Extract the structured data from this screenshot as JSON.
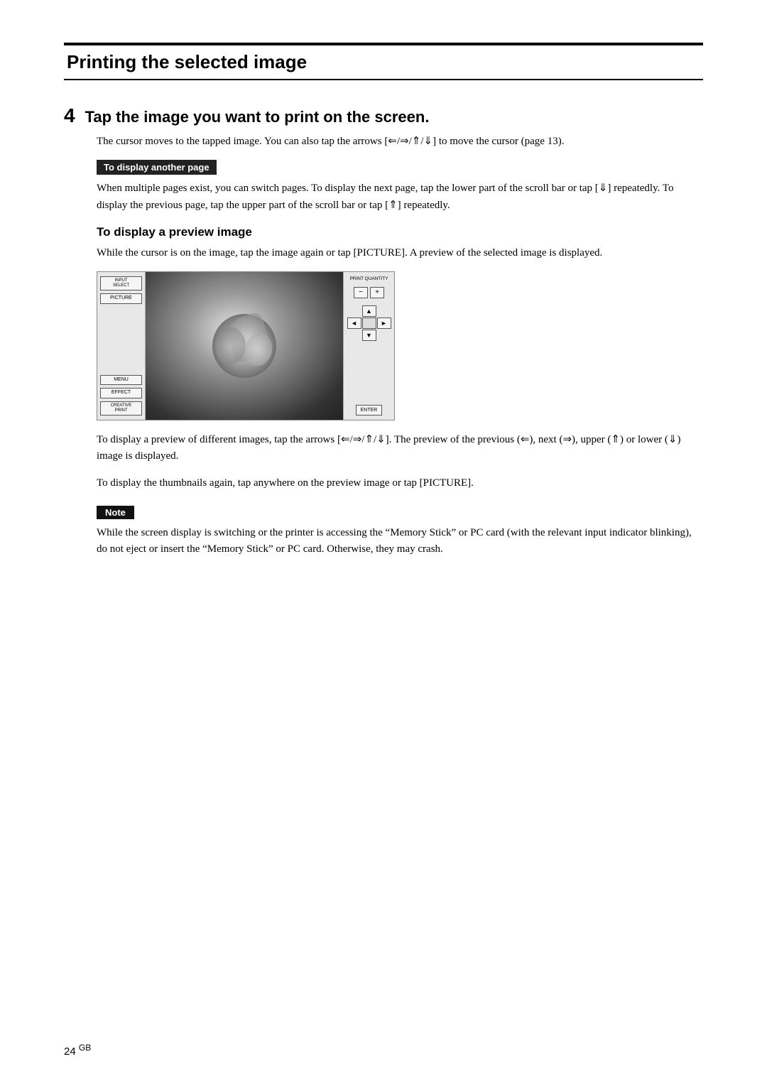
{
  "page": {
    "section_title": "Printing the selected image",
    "step_number": "4",
    "step_title": "Tap the image you want to print on the screen.",
    "step_desc": "The cursor moves to the tapped image.  You can also tap the arrows [⇐/⇒/⇑/⇓] to move the cursor (page 13).",
    "note_box_label": "To display another page",
    "note_box_text": "When multiple pages exist, you can switch pages. To display the next page, tap the lower part of the scroll bar or tap [⇓] repeatedly.  To display the previous page, tap the upper part of the scroll bar or tap [⇑] repeatedly.",
    "sub_heading": "To display a preview image",
    "sub_body_1": "While the cursor is on the image, tap the image again or tap [PICTURE]. A preview of the selected image is displayed.",
    "preview_desc_1": "To display a preview of different images, tap the arrows [⇐/⇒/⇑/⇓].  The preview of  the previous (⇐), next (⇒), upper (⇑) or lower (⇓) image is displayed.",
    "preview_desc_2": "To display the thumbnails again, tap anywhere on the preview image or tap [PICTURE].",
    "note_label": "Note",
    "note_text": "While the screen display is switching or the printer is accessing the “Memory Stick” or PC card (with the relevant input indicator blinking), do not eject or insert the “Memory Stick” or PC card. Otherwise, they may crash.",
    "page_number": "24",
    "page_suffix": "GB",
    "device": {
      "btn_input_select": "INPUT\nSELECT",
      "btn_picture": "PICTURE",
      "btn_menu": "MENU",
      "btn_effect": "EFFECT",
      "btn_creative": "CREATIVE\nPRINT",
      "print_qty_label": "PRINT QUANTITY",
      "qty_minus": "−",
      "qty_plus": "+",
      "nav_up": "▲",
      "nav_left": "◄",
      "nav_center": "",
      "nav_right": "►",
      "nav_down": "▼",
      "enter_label": "ENTER"
    }
  }
}
